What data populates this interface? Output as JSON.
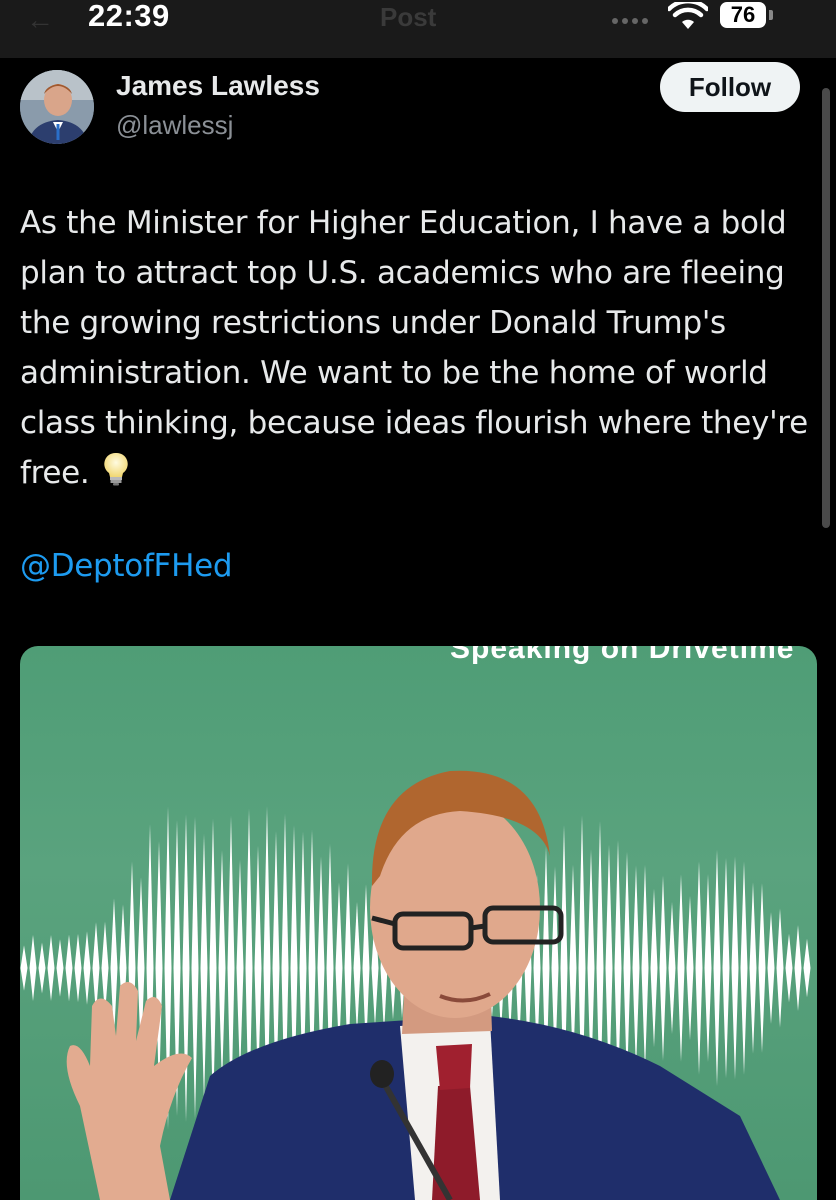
{
  "status_bar": {
    "time": "22:39",
    "battery": "76",
    "header_title": "Post"
  },
  "author": {
    "name": "James Lawless",
    "handle": "@lawlessj",
    "follow_label": "Follow"
  },
  "tweet": {
    "text": "As the Minister for Higher Education, I have a bold plan to attract top U.S. academics who are fleeing the growing restrictions under Donald Trump's administration. We want to be the home of world class thinking, because ideas flourish where they're free.",
    "mention": "@DeptofFHed",
    "emoji_icon": "lightbulb-icon"
  },
  "media": {
    "caption": "Speaking on Drivetime",
    "background_color": "#56a07a"
  },
  "colors": {
    "link": "#1d9bf0",
    "text": "#e7e9ea",
    "secondary": "#8b9096"
  }
}
